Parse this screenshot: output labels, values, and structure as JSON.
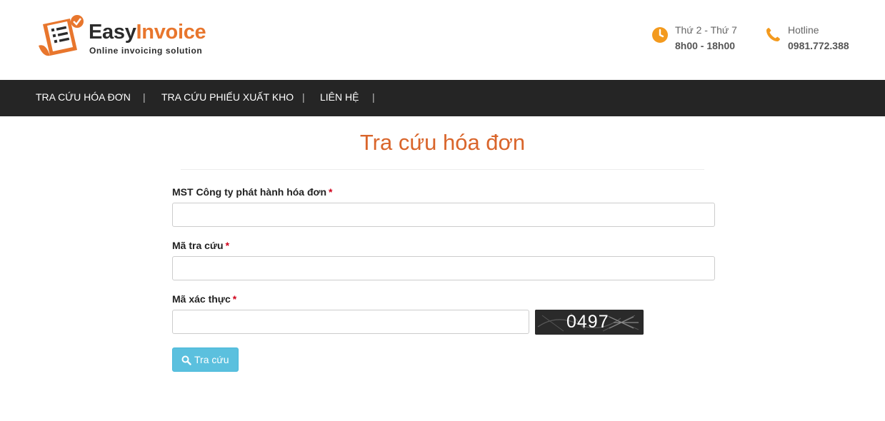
{
  "header": {
    "logo_name_part1": "Easy",
    "logo_name_part2": "Invoice",
    "logo_tagline": "Online invoicing solution",
    "hours": {
      "icon": "clock-icon",
      "line1": "Thứ 2 - Thứ 7",
      "line2": "8h00 - 18h00"
    },
    "hotline": {
      "icon": "phone-icon",
      "line1": "Hotline",
      "line2": "0981.772.388"
    }
  },
  "nav": {
    "items": [
      {
        "label": "TRA CỨU HÓA ĐƠN"
      },
      {
        "label": "TRA CỨU PHIẾU XUẤT KHO"
      },
      {
        "label": "LIÊN HỆ"
      }
    ],
    "separator": "|"
  },
  "form": {
    "title": "Tra cứu hóa đơn",
    "required_mark": "*",
    "fields": [
      {
        "label": "MST Công ty phát hành hóa đơn",
        "value": ""
      },
      {
        "label": "Mã tra cứu",
        "value": ""
      },
      {
        "label": "Mã xác thực",
        "value": ""
      }
    ],
    "captcha_text": "0497",
    "submit": {
      "icon": "search-icon",
      "label": "Tra cứu"
    }
  },
  "colors": {
    "brand_orange": "#e8762d",
    "title_orange": "#d9652b",
    "nav_bg": "#252525",
    "button_info": "#5bc0de",
    "required_red": "#d0021b"
  }
}
